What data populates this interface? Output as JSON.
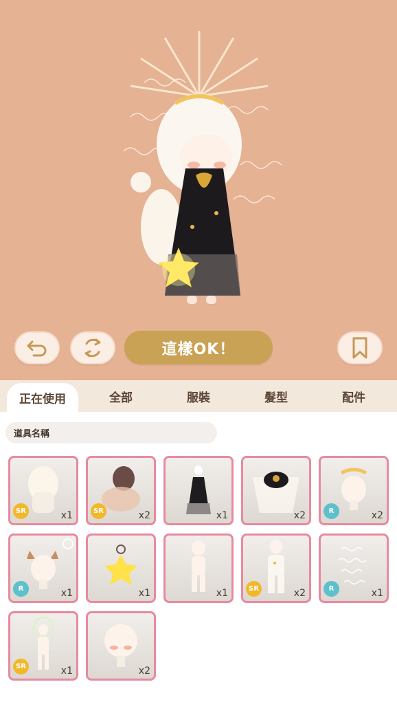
{
  "toolbar": {
    "undo_icon": "undo-arrow-icon",
    "refresh_icon": "refresh-cycle-icon",
    "ok_label": "這樣OK！",
    "bookmark_icon": "bookmark-icon"
  },
  "tabs": [
    {
      "label": "正在使用",
      "active": true
    },
    {
      "label": "全部",
      "active": false
    },
    {
      "label": "服裝",
      "active": false
    },
    {
      "label": "髮型",
      "active": false
    },
    {
      "label": "配件",
      "active": false
    }
  ],
  "search": {
    "placeholder": "道具名稱"
  },
  "items": [
    {
      "rarity": "SR",
      "qty": "x1",
      "thumb": "curly-hair-icon"
    },
    {
      "rarity": "SR",
      "qty": "x2",
      "thumb": "brown-hair-icon"
    },
    {
      "rarity": "",
      "qty": "x1",
      "thumb": "black-dress-icon"
    },
    {
      "rarity": "",
      "qty": "x2",
      "thumb": "black-cape-icon"
    },
    {
      "rarity": "R",
      "qty": "x2",
      "thumb": "gold-crown-icon"
    },
    {
      "rarity": "R",
      "qty": "x1",
      "thumb": "horned-head-icon"
    },
    {
      "rarity": "",
      "qty": "x1",
      "thumb": "star-lantern-icon"
    },
    {
      "rarity": "",
      "qty": "x1",
      "thumb": "gold-anklets-icon"
    },
    {
      "rarity": "SR",
      "qty": "x2",
      "thumb": "star-pajamas-icon"
    },
    {
      "rarity": "R",
      "qty": "x1",
      "thumb": "script-background-icon"
    },
    {
      "rarity": "SR",
      "qty": "x1",
      "thumb": "halo-figure-icon"
    },
    {
      "rarity": "",
      "qty": "x2",
      "thumb": "blush-face-icon"
    }
  ],
  "colors": {
    "preview_bg": "#e5b293",
    "ok_button": "#c9a255",
    "item_border": "#e78aa0",
    "sr_badge": "#f2b82a",
    "r_badge": "#5dc0cb"
  }
}
